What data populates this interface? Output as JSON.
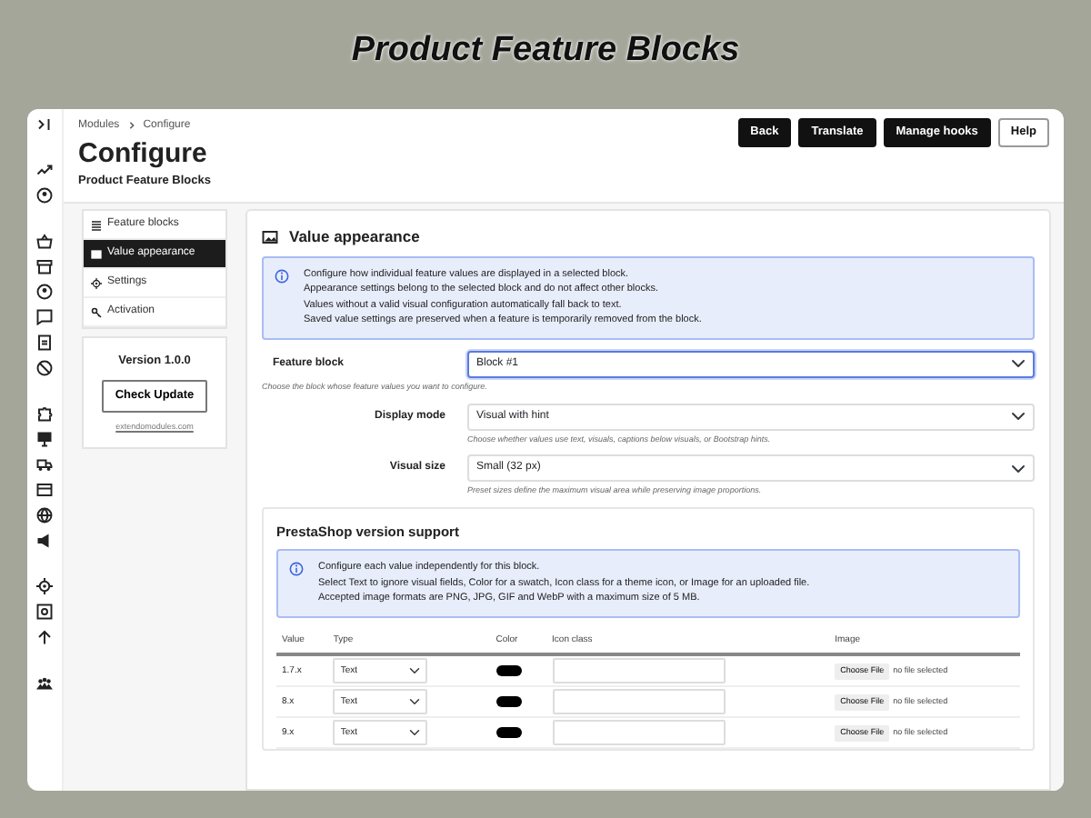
{
  "page_title": "Product Feature Blocks",
  "breadcrumb": [
    "Modules",
    "Configure"
  ],
  "heading": "Configure",
  "subheading": "Product Feature Blocks",
  "header_buttons": [
    {
      "label": "Back",
      "kind": "dark"
    },
    {
      "label": "Translate",
      "kind": "dark"
    },
    {
      "label": "Manage hooks",
      "kind": "dark"
    },
    {
      "label": "Help",
      "kind": "light"
    }
  ],
  "side_menu": [
    {
      "label": "Feature blocks",
      "selected": false
    },
    {
      "label": "Value appearance",
      "selected": true
    },
    {
      "label": "Settings",
      "selected": false
    },
    {
      "label": "Activation",
      "selected": false
    }
  ],
  "version_card": {
    "version": "Version 1.0.0",
    "button": "Check Update",
    "link": "extendomodules.com"
  },
  "panel": {
    "title": "Value appearance",
    "info": [
      "Configure how individual feature values are displayed in a selected block.",
      "Appearance settings belong to the selected block and do not affect other blocks.",
      "Values without a valid visual configuration automatically fall back to text.",
      "Saved value settings are preserved when a feature is temporarily removed from the block."
    ],
    "fields": [
      {
        "label": "Feature block",
        "value": "Block #1",
        "hint": "Choose the block whose feature values you want to configure.",
        "focused": true
      },
      {
        "label": "Display mode",
        "value": "Visual with hint",
        "hint": "Choose whether values use text, visuals, captions below visuals, or Bootstrap hints.",
        "focused": false
      },
      {
        "label": "Visual size",
        "value": "Small (32 px)",
        "hint": "Preset sizes define the maximum visual area while preserving image proportions.",
        "focused": false
      }
    ],
    "subpanel": {
      "title": "PrestaShop version support",
      "info": [
        "Configure each value independently for this block.",
        "Select Text to ignore visual fields, Color for a swatch, Icon class for a theme icon, or Image for an uploaded file.",
        "Accepted image formats are PNG, JPG, GIF and WebP with a maximum size of 5 MB."
      ],
      "table": {
        "columns": [
          "Value",
          "Type",
          "Color",
          "Icon class",
          "Image"
        ],
        "rows": [
          {
            "value": "1.7.x",
            "type": "Text",
            "color": "#000000",
            "file_button": "Choose File",
            "file_status": "no file selected"
          },
          {
            "value": "8.x",
            "type": "Text",
            "color": "#000000",
            "file_button": "Choose File",
            "file_status": "no file selected"
          },
          {
            "value": "9.x",
            "type": "Text",
            "color": "#000000",
            "file_button": "Choose File",
            "file_status": "no file selected"
          }
        ]
      }
    }
  }
}
